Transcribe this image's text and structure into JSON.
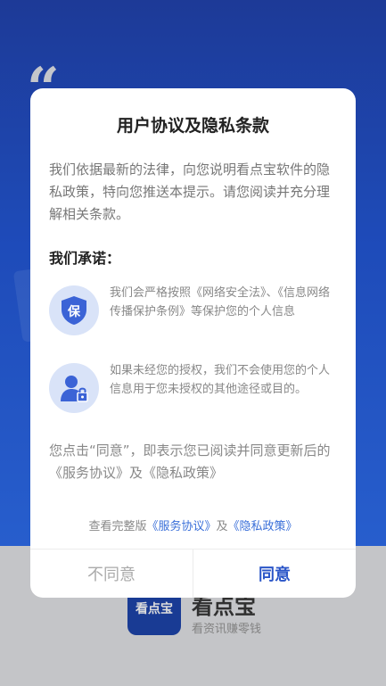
{
  "background": {
    "quote_mark": "“",
    "brand": {
      "logo_text": "看点宝",
      "name": "看点宝",
      "slogan": "看资讯赚零钱"
    }
  },
  "dialog": {
    "title": "用户协议及隐私条款",
    "intro": "我们依据最新的法律，向您说明看点宝软件的隐私政策，特向您推送本提示。请您阅读并充分理解相关条款。",
    "promise_heading": "我们承诺：",
    "items": [
      {
        "icon": "shield-icon",
        "icon_text": "保",
        "text": "我们会严格按照《网络安全法》、《信息网络传播保护条例》等保护您的个人信息"
      },
      {
        "icon": "user-lock-icon",
        "text": "如果未经您的授权，我们不会使用您的个人信息用于您未授权的其他途径或目的。"
      }
    ],
    "note": "您点击“同意”，即表示您已阅读并同意更新后的《服务协议》及《隐私政策》",
    "links": {
      "prefix": "查看完整版",
      "service": "《服务协议》",
      "and": "及",
      "privacy": "《隐私政策》"
    },
    "buttons": {
      "disagree": "不同意",
      "agree": "同意"
    }
  },
  "colors": {
    "accent": "#2b56c8",
    "link": "#3a6fd9",
    "icon_bg": "#d9e3f8",
    "icon_fg": "#3b63d6"
  }
}
